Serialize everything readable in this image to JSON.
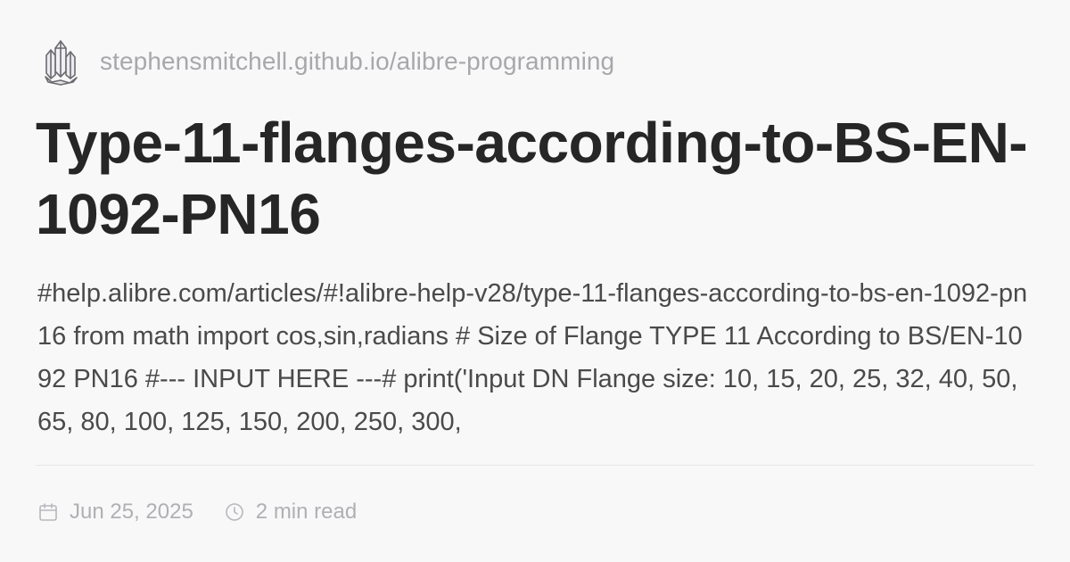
{
  "site": {
    "logo_icon": "crystal-cluster-icon",
    "url": "stephensmitchell.github.io/alibre-programming"
  },
  "post": {
    "title": "Type-11-flanges-according-to-BS-EN-1092-PN16",
    "excerpt": "#help.alibre.com/articles/#!alibre-help-v28/type-11-flanges-according-to-bs-en-1092-pn16 from math import cos,sin,radians # Size of Flange TYPE 11 According to BS/EN-1092 PN16 #--- INPUT HERE ---# print('Input DN Flange size: 10, 15, 20, 25, 32, 40, 50, 65, 80, 100, 125, 150, 200, 250, 300,"
  },
  "meta": {
    "date_icon": "calendar-icon",
    "date": "Jun 25, 2025",
    "read_time_icon": "clock-icon",
    "read_time": "2 min read"
  },
  "colors": {
    "background": "#f8f8f9",
    "title": "#262626",
    "body": "#4a4a4a",
    "muted": "#a8a8ac"
  }
}
